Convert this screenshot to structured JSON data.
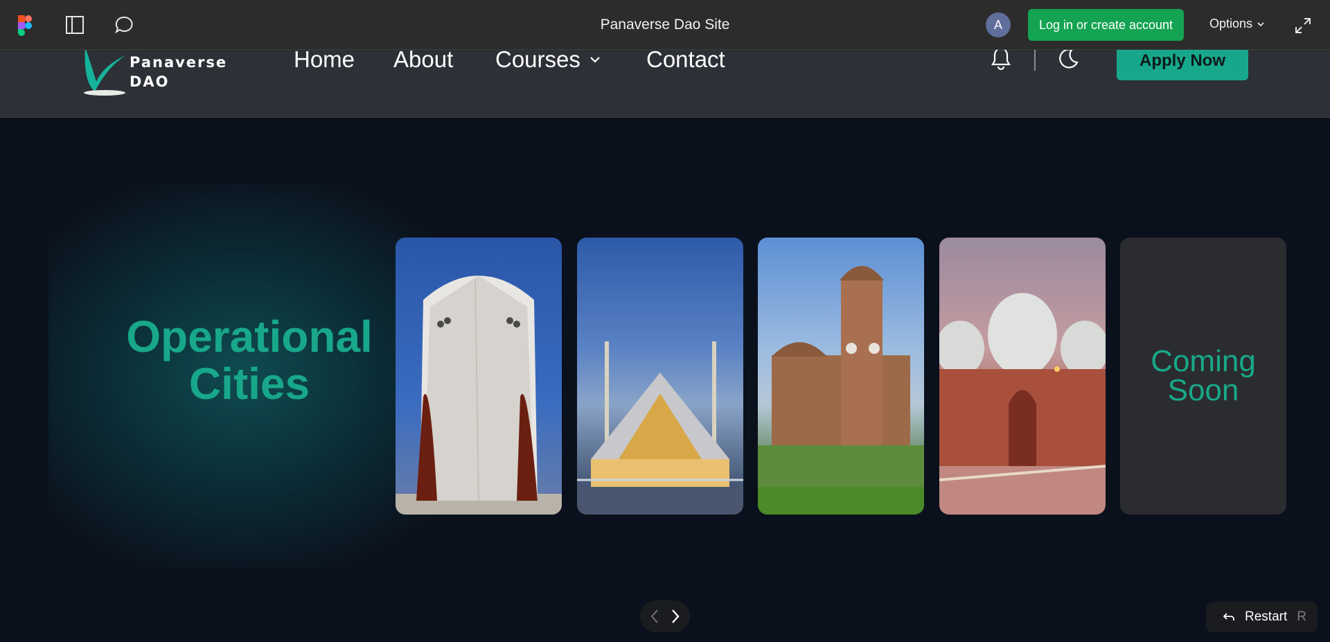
{
  "figma_bar": {
    "title": "Panaverse Dao Site",
    "avatar_letter": "A",
    "login_label": "Log in or create account",
    "options_label": "Options"
  },
  "site": {
    "logo_line1": "Panaverse",
    "logo_line2": "DAO",
    "nav": {
      "home": "Home",
      "about": "About",
      "courses": "Courses",
      "contact": "Contact"
    },
    "apply_label": "Apply Now"
  },
  "hero": {
    "title_line1": "Operational",
    "title_line2": "Cities",
    "coming_line1": "Coming",
    "coming_line2": "Soon"
  },
  "controls": {
    "restart_label": "Restart",
    "restart_key": "R"
  },
  "colors": {
    "accent": "#18a889",
    "figma_bar": "#2c2c2c",
    "login_green": "#14a352",
    "background": "#0b111c"
  }
}
